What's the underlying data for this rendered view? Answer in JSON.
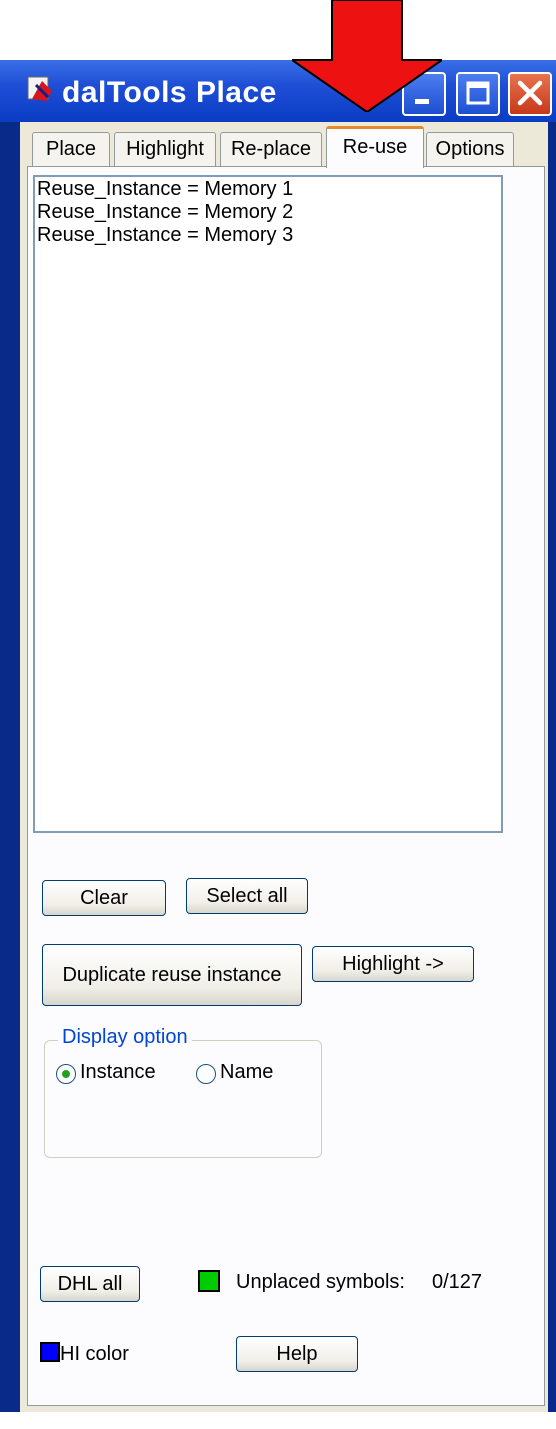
{
  "window": {
    "title": "dalTools Place",
    "minimize_label": "minimize",
    "maximize_label": "maximize",
    "close_label": "close"
  },
  "tabs": [
    {
      "label": "Place"
    },
    {
      "label": "Highlight"
    },
    {
      "label": "Re-place"
    },
    {
      "label": "Re-use",
      "active": true
    },
    {
      "label": "Options"
    }
  ],
  "list": {
    "items": [
      "Reuse_Instance = Memory 1",
      "Reuse_Instance = Memory 2",
      "Reuse_Instance = Memory 3"
    ]
  },
  "buttons": {
    "clear": "Clear",
    "select_all": "Select all",
    "duplicate": "Duplicate reuse instance",
    "highlight": "Highlight ->",
    "dhl_all": "DHL all",
    "help": "Help"
  },
  "display_option": {
    "legend": "Display option",
    "options": [
      {
        "label": "Instance",
        "selected": true
      },
      {
        "label": "Name",
        "selected": false
      }
    ]
  },
  "status": {
    "unplaced_label": "Unplaced symbols:",
    "unplaced_value": "0/127",
    "unplaced_swatch_color": "#00cc00",
    "hi_color_label": "HI color",
    "hi_color_swatch_color": "#0000ff"
  },
  "colors": {
    "titlebar": "#1f4fd6",
    "client": "#ece9d8",
    "active_tab_accent": "#e68b2c",
    "annotation_arrow": "#ee1111"
  }
}
